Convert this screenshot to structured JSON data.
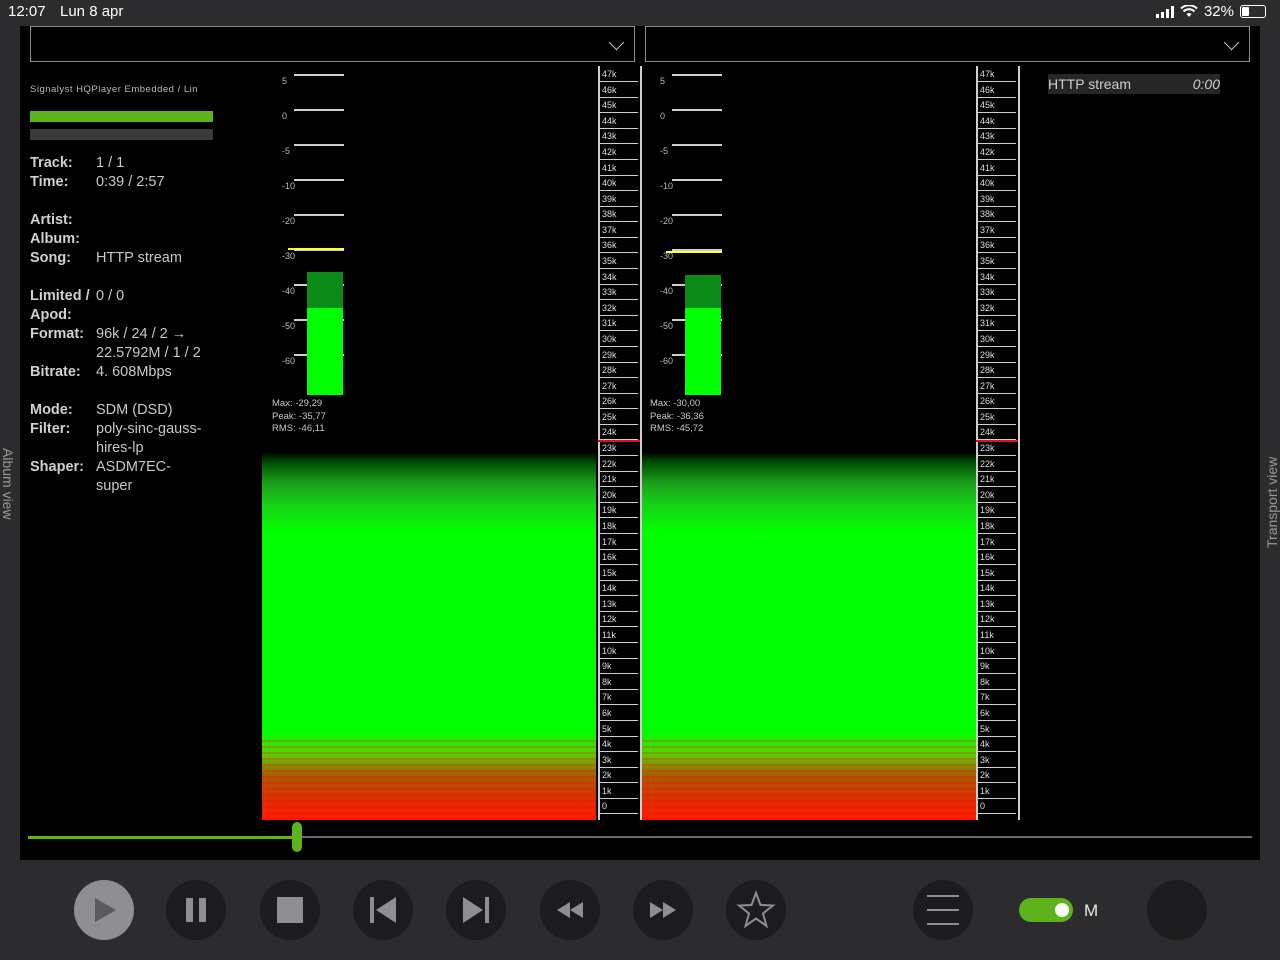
{
  "status_bar": {
    "time": "12:07",
    "date": "Lun 8 apr",
    "battery": "32%"
  },
  "side_tabs": {
    "left": "Album view",
    "right": "Transport view"
  },
  "device_name": "Signalyst HQPlayer Embedded / Lin",
  "info_rows": [
    {
      "key": "Track:",
      "value": "1 / 1"
    },
    {
      "key": "Time:",
      "value": "0:39 / 2:57"
    },
    {
      "key": "",
      "value": ""
    },
    {
      "key": "Artist:",
      "value": ""
    },
    {
      "key": "Album:",
      "value": ""
    },
    {
      "key": "Song:",
      "value": "HTTP stream"
    },
    {
      "key": "",
      "value": ""
    },
    {
      "key": "Limited / Apod:",
      "value": "0 / 0"
    },
    {
      "key": "Format:",
      "value": "96k / 24 / 2 → 22.5792M / 1 / 2"
    },
    {
      "key": "Bitrate:",
      "value": "4. 608Mbps"
    },
    {
      "key": "",
      "value": ""
    },
    {
      "key": "Mode:",
      "value": "SDM (DSD)"
    },
    {
      "key": "Filter:",
      "value": "poly-sinc-gauss-hires-lp"
    },
    {
      "key": "Shaper:",
      "value": "ASDM7EC-super"
    }
  ],
  "meter_scale_labels": [
    "5",
    "0",
    "-5",
    "-10",
    "-20",
    "-30",
    "-40",
    "-50",
    "-60"
  ],
  "channels": [
    {
      "max": "Max: -29,29",
      "peak": "Peak: -35,77",
      "rms": "RMS: -46,11"
    },
    {
      "max": "Max: -30,00",
      "peak": "Peak: -36,36",
      "rms": "RMS: -45,72"
    }
  ],
  "freq_labels": [
    "47k",
    "46k",
    "45k",
    "44k",
    "43k",
    "42k",
    "41k",
    "40k",
    "39k",
    "38k",
    "37k",
    "36k",
    "35k",
    "34k",
    "33k",
    "32k",
    "31k",
    "30k",
    "29k",
    "28k",
    "27k",
    "26k",
    "25k",
    "24k",
    "23k",
    "22k",
    "21k",
    "20k",
    "19k",
    "18k",
    "17k",
    "16k",
    "15k",
    "14k",
    "13k",
    "12k",
    "11k",
    "10k",
    "9k",
    "8k",
    "7k",
    "6k",
    "5k",
    "4k",
    "3k",
    "2k",
    "1k",
    "0"
  ],
  "stream": {
    "label": "HTTP stream",
    "time": "0:00"
  },
  "playback_progress": 0.22,
  "transport": {
    "buttons": [
      "play-icon",
      "pause-icon",
      "stop-icon",
      "previous-icon",
      "next-icon",
      "rewind-icon",
      "fast-forward-icon",
      "star-icon",
      "menu-icon"
    ],
    "mode_label": "M"
  },
  "colors": {
    "accent": "#5cb31c",
    "meter": "#00ff00",
    "peak_line": "#ffff3a",
    "limit_line": "#e0101a"
  }
}
